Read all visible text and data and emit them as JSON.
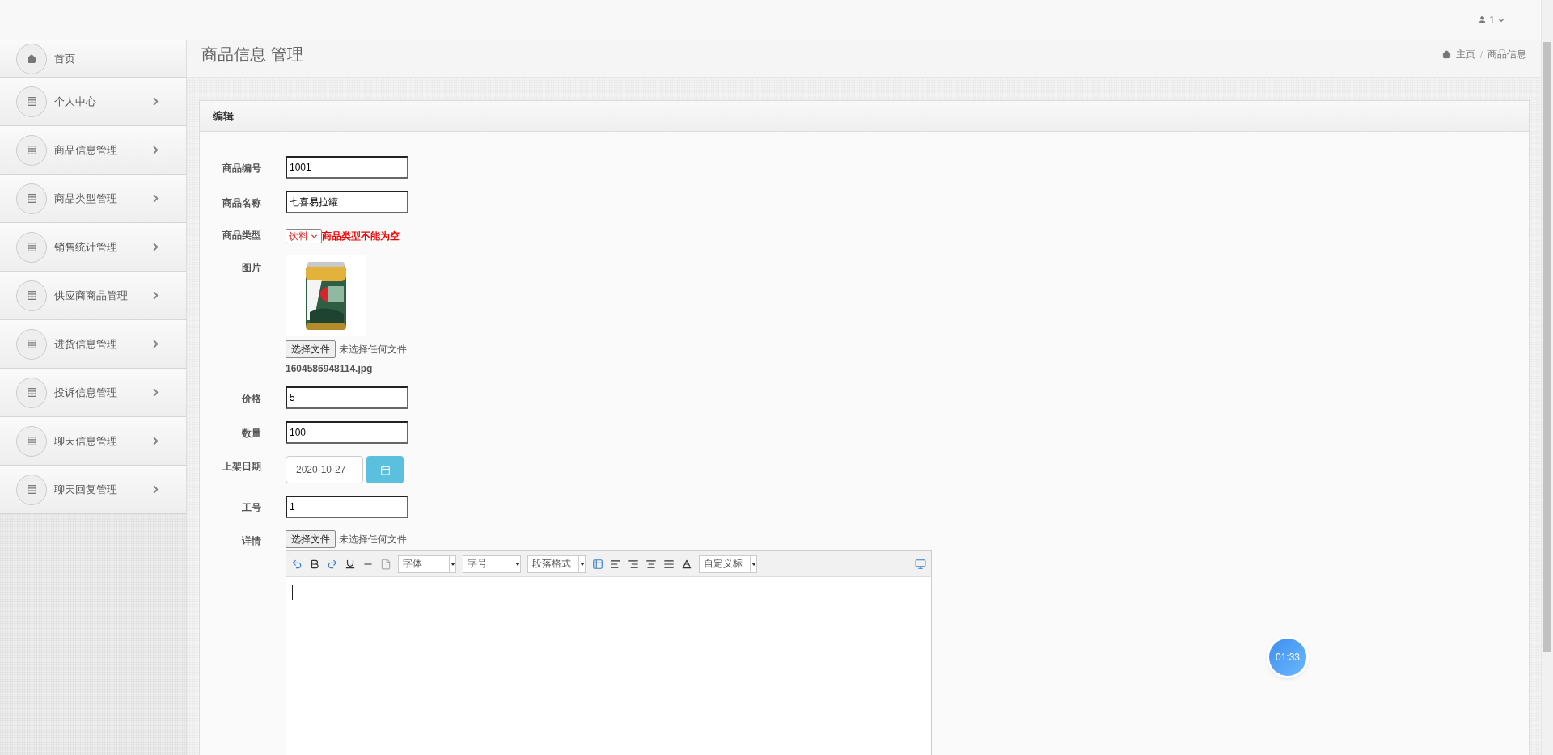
{
  "top_bar": {
    "user": "1"
  },
  "sidebar": {
    "items": [
      {
        "kind": "home",
        "label": "首页"
      },
      {
        "kind": "menu",
        "label": "个人中心"
      },
      {
        "kind": "menu",
        "label": "商品信息管理"
      },
      {
        "kind": "menu",
        "label": "商品类型管理"
      },
      {
        "kind": "menu",
        "label": "销售统计管理"
      },
      {
        "kind": "menu",
        "label": "供应商商品管理"
      },
      {
        "kind": "menu",
        "label": "进货信息管理"
      },
      {
        "kind": "menu",
        "label": "投诉信息管理"
      },
      {
        "kind": "menu",
        "label": "聊天信息管理"
      },
      {
        "kind": "menu",
        "label": "聊天回复管理"
      }
    ]
  },
  "page_header": {
    "title": "商品信息 管理",
    "breadcrumb": [
      "主页",
      "商品信息"
    ],
    "separator": "/"
  },
  "panel": {
    "title": "编辑",
    "fields": [
      {
        "kind": "text",
        "label": "商品编号",
        "value": "1001"
      },
      {
        "kind": "text",
        "label": "商品名称",
        "value": "七喜易拉罐"
      },
      {
        "kind": "select",
        "label": "商品类型",
        "value": "饮料",
        "error": "商品类型不能为空"
      },
      {
        "label": "图片",
        "file_button": "选择文件",
        "file_status": "未选择任何文件",
        "filename": "1604586948114.jpg"
      },
      {
        "kind": "text",
        "label": "价格",
        "value": "5"
      },
      {
        "kind": "text",
        "label": "数量",
        "value": "100"
      },
      {
        "kind": "date",
        "label": "上架日期",
        "value": "2020-10-27"
      },
      {
        "kind": "text",
        "label": "工号",
        "value": "1"
      },
      {
        "kind": "editor",
        "label": "详情",
        "file_button": "选择文件",
        "file_status": "未选择任何文件",
        "toolbar": {
          "font": "字体",
          "size": "字号",
          "paragraph": "段落格式",
          "heading": "自定义标"
        }
      }
    ]
  },
  "timer": "01:33"
}
